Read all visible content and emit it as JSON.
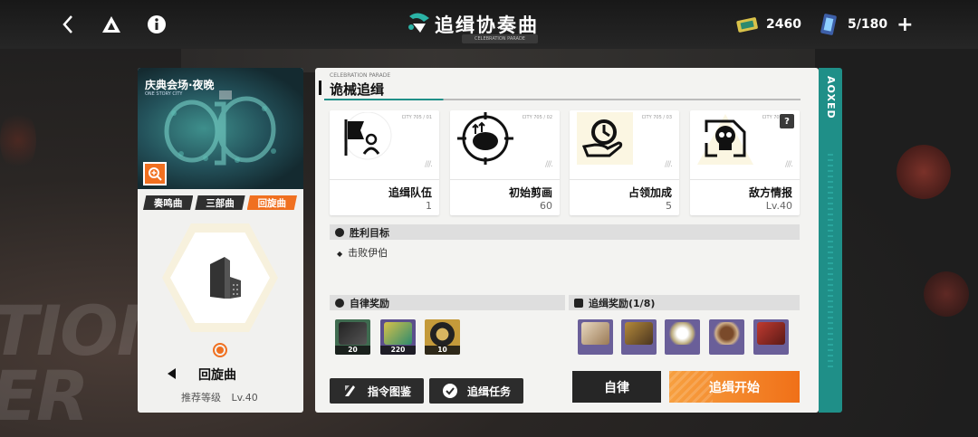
{
  "header": {
    "title": "追缉协奏曲",
    "subtitle": "CELEBRATION PARADE",
    "tickets": "2460",
    "stamina": "5/180",
    "plus_label": "+"
  },
  "left_panel": {
    "map_title": "庆典会场·夜晚",
    "map_sub": "ONE STORY CITY",
    "tabs": [
      "奏鸣曲",
      "三部曲",
      "回旋曲"
    ],
    "active_tab": "回旋曲",
    "mode_name": "回旋曲",
    "level_label": "推荐等级",
    "level_value": "Lv.40"
  },
  "main": {
    "section_sub": "CELEBRATION PARADE",
    "section_title": "诡械追缉",
    "cards": [
      {
        "code": "CITY 705 / 01",
        "label": "追缉队伍",
        "value": "1"
      },
      {
        "code": "CITY 705 / 02",
        "label": "初始剪画",
        "value": "60"
      },
      {
        "code": "CITY 705 / 03",
        "label": "占领加成",
        "value": "5"
      },
      {
        "code": "CITY 705 / 04",
        "label": "敌方情报",
        "value": "Lv.40",
        "help": "?"
      }
    ],
    "victory_title": "胜利目标",
    "victory_item": "击败伊伯",
    "self_reward_title": "自律奖励",
    "self_rewards": [
      "20",
      "220",
      "10"
    ],
    "chase_reward_title": "追缉奖励(1/8)",
    "chase_rewards_count": 5,
    "buttons": {
      "command": "指令图鉴",
      "mission": "追缉任务",
      "auto": "自律",
      "start": "追缉开始"
    },
    "strip_text": "AOXED"
  },
  "colors": {
    "accent": "#f07020",
    "teal": "#1f8f88",
    "dark": "#262626"
  }
}
